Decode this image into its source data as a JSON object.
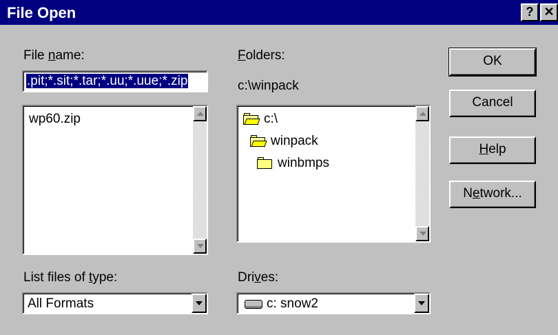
{
  "window": {
    "title": "File Open",
    "help_button": "?",
    "close_button": "✕"
  },
  "filename": {
    "label_pre": "File ",
    "label_accel": "n",
    "label_post": "ame:",
    "value": ".pit;*.sit;*.tar;*.uu;*.uue;*.zip"
  },
  "file_list": {
    "items": [
      "wp60.zip"
    ]
  },
  "folders": {
    "label_accel": "F",
    "label_post": "olders:",
    "current_path": "c:\\winpack",
    "items": [
      {
        "name": "c:\\",
        "icon": "open-folder-icon"
      },
      {
        "name": "winpack",
        "icon": "open-folder-icon"
      },
      {
        "name": "winbmps",
        "icon": "folder-icon"
      }
    ]
  },
  "buttons": {
    "ok": "OK",
    "cancel": "Cancel",
    "help_accel": "H",
    "help_post": "elp",
    "network_pre": "N",
    "network_accel": "e",
    "network_post": "twork..."
  },
  "file_type": {
    "label_pre": "List files of ",
    "label_accel": "t",
    "label_post": "ype:",
    "value": "All Formats"
  },
  "drives": {
    "label_pre": "Dri",
    "label_accel": "v",
    "label_post": "es:",
    "value": "c: snow2"
  }
}
